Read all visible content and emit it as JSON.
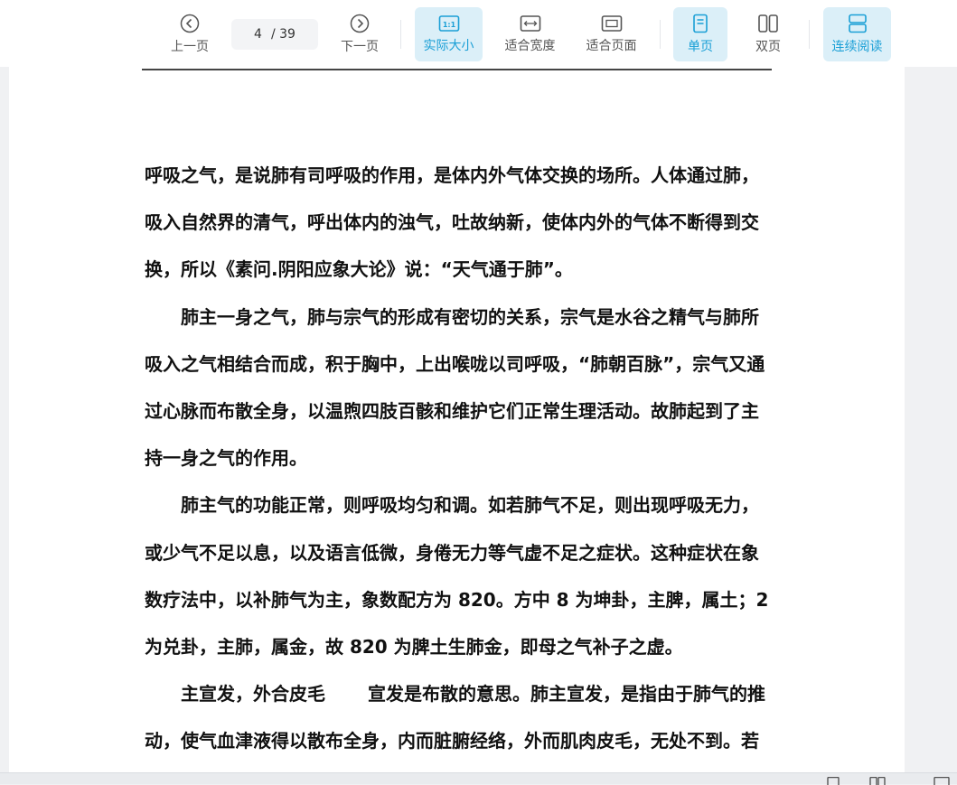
{
  "toolbar": {
    "prev_label": "上一页",
    "next_label": "下一页",
    "page_current": "4",
    "page_total": "/ 39",
    "actual_size_label": "实际大小",
    "fit_width_label": "适合宽度",
    "fit_page_label": "适合页面",
    "single_page_label": "单页",
    "double_page_label": "双页",
    "continuous_label": "连续阅读",
    "active_color": "#1a9fd6"
  },
  "document": {
    "lines": [
      "呼吸之气，是说肺有司呼吸的作用，是体内外气体交换的场所。人体通过肺，",
      "吸入自然界的清气，呼出体内的浊气，吐故纳新，使体内外的气体不断得到交",
      "换，所以《素问.阴阳应象大论》说：“天气通于肺”。",
      "肺主一身之气，肺与宗气的形成有密切的关系，宗气是水谷之精气与肺所",
      "吸入之气相结合而成，积于胸中，上出喉咙以司呼吸，“肺朝百脉”，宗气又通",
      "过心脉而布散全身，以温煦四肢百骸和维护它们正常生理活动。故肺起到了主",
      "持一身之气的作用。",
      "肺主气的功能正常，则呼吸均匀和调。如若肺气不足，则出现呼吸无力，",
      "或少气不足以息，以及语言低微，身倦无力等气虚不足之症状。这种症状在象",
      "数疗法中，以补肺气为主，象数配方为 820。方中 8 为坤卦，主脾，属土；2",
      "为兑卦，主肺，属金，故 820 为脾土生肺金，即母之气补子之虚。",
      "主宣发，外合皮毛　　 宣发是布散的意思。肺主宣发，是指由于肺气的推",
      "动，使气血津液得以散布全身，内而脏腑经络，外而肌肉皮毛，无处不到。若"
    ]
  }
}
